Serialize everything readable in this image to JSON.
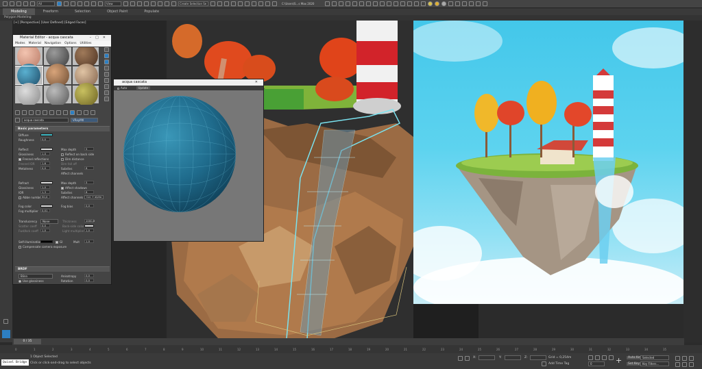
{
  "toolbar": {
    "selection_filter": "All",
    "view_dropdown": "View",
    "selection_set": "Create Selection Se",
    "file_path": "C:\\Users\\S...s Max 2020",
    "icons": [
      "undo-icon",
      "redo-icon",
      "link-icon",
      "unlink-icon",
      "bind-icon",
      "select-icon",
      "select-name-icon",
      "rect-select-icon",
      "window-crossing-icon",
      "move-icon",
      "rotate-icon",
      "scale-icon",
      "snap-icon",
      "angle-snap-icon",
      "percent-snap-icon",
      "spinner-snap-icon",
      "mirror-icon",
      "align-icon",
      "render-setup-icon",
      "render-frame-icon",
      "render-icon"
    ]
  },
  "ribbon": {
    "tabs": [
      "Modeling",
      "Freeform",
      "Selection",
      "Object Paint",
      "Populate"
    ],
    "active_tab": "Modeling",
    "subtitle": "Polygon Modeling"
  },
  "viewport": {
    "label": "[+] [Perspective] [User Defined] [Edged Faces]"
  },
  "material_editor": {
    "title": "Material Editor - acqua cascata",
    "menus": [
      "Modes",
      "Material",
      "Navigation",
      "Options",
      "Utilities"
    ],
    "material_name": "acqua cascata",
    "material_type": "VRayMtl",
    "sections": {
      "basic": "Basic parameters",
      "brdf": "BRDF"
    },
    "params": {
      "diffuse": "Diffuse",
      "diffuse_roughness_label": "Roughness",
      "diffuse_roughness": "0,0",
      "reflect": "Reflect",
      "max_depth_label": "Max depth",
      "max_depth": "5",
      "glossiness_label": "Glossiness",
      "glossiness": "1,0",
      "reflect_on_back": "Reflect on back side",
      "fresnel": "Fresnel reflections",
      "dim_distance": "Dim distance",
      "fresnel_ior": "Fresnel IOR",
      "fresnel_ior_val": "1,6",
      "dim_falloff": "Dim fall off",
      "metalness_label": "Metalness",
      "metalness": "0,0",
      "subdivs_label": "Subdivs",
      "subdivs": "8",
      "affect_channels": "Affect channels",
      "affect_val": "Col. only",
      "refract": "Refract",
      "refract_max_depth": "5",
      "refract_gloss": "1,0",
      "affect_shadows": "Affect shadows",
      "ior_label": "IOR",
      "ior": "1,3",
      "refract_subdivs": "8",
      "abbe": "Abbe number",
      "abbe_val": "50,0",
      "refract_affect": "Col. + alpha",
      "fog_color": "Fog color",
      "fog_bias_label": "Fog bias",
      "fog_bias": "0,0",
      "fog_multiplier_label": "Fog multiplier",
      "fog_multiplier": "0,01",
      "translucency_label": "Translucency",
      "translucency": "None",
      "thickness_label": "Thickness",
      "thickness": "1000,0",
      "scatter_coeff": "Scatter coeff",
      "scatter_val": "0,0",
      "back_side_color": "Back-side color",
      "fwd_bck_coeff": "Fwd/bck coeff",
      "fwd_val": "1,0",
      "light_multiplier": "Light multiplier",
      "light_val": "1,0",
      "self_illum": "Self-illumination",
      "gi_label": "GI",
      "mult_label": "Mult",
      "mult": "1,0",
      "compensate": "Compensate camera exposure",
      "brdf_type": "Blinn",
      "anisotropy_label": "Anisotropy",
      "anisotropy": "0,0",
      "use_glossiness": "Use glossiness",
      "rotation_label": "Rotation",
      "rotation": "0,0"
    }
  },
  "preview": {
    "title": "acqua cascata",
    "bar_label": "Auto",
    "bar_button": "Update"
  },
  "timeline": {
    "frame": "0 / 35",
    "ticks": [
      "0",
      "1",
      "2",
      "3",
      "4",
      "5",
      "6",
      "7",
      "8",
      "9",
      "10",
      "11",
      "12",
      "13",
      "14",
      "15",
      "16",
      "17",
      "18",
      "19",
      "20",
      "21",
      "22",
      "23",
      "24",
      "25",
      "26",
      "27",
      "28",
      "29",
      "30",
      "31",
      "32",
      "33",
      "34",
      "35"
    ]
  },
  "status": {
    "script_label": "Quixel Bridge",
    "objects_selected": "1 Object Selected",
    "prompt": "Click or click-and-drag to select objects",
    "x_label": "X:",
    "y_label": "Y:",
    "z_label": "Z:",
    "grid": "Grid = 0,254m",
    "add_time_tag": "Add Time Tag",
    "auto_key": "Auto Key",
    "selected": "Selected",
    "set_key": "Set Key",
    "key_filters": "Key Filters...",
    "frame_field": "0"
  },
  "colors": {
    "diffuse_swatch": "#3fb9c4",
    "sky_top": "#43c7ea",
    "sky_bottom": "#c9eef8",
    "accent_blue": "#2d7fc2"
  }
}
